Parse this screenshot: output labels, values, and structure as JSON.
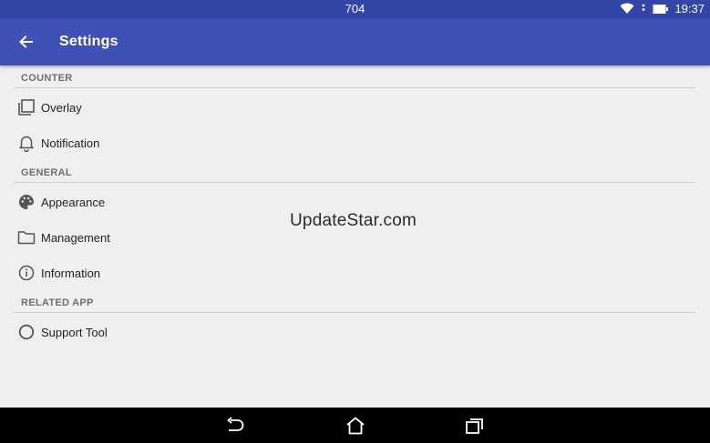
{
  "status_bar": {
    "center_text": "704",
    "time": "19:37"
  },
  "app_bar": {
    "title": "Settings"
  },
  "sections": [
    {
      "header": "COUNTER",
      "items": [
        {
          "label": "Overlay",
          "icon": "overlay-icon"
        },
        {
          "label": "Notification",
          "icon": "bell-icon"
        }
      ]
    },
    {
      "header": "GENERAL",
      "items": [
        {
          "label": "Appearance",
          "icon": "palette-icon"
        },
        {
          "label": "Management",
          "icon": "folder-icon"
        },
        {
          "label": "Information",
          "icon": "info-icon"
        }
      ]
    },
    {
      "header": "RELATED APP",
      "items": [
        {
          "label": "Support Tool",
          "icon": "circle-icon"
        }
      ]
    }
  ],
  "watermark": "UpdateStar.com",
  "colors": {
    "status_bar": "#3445a8",
    "app_bar": "#3f51b5",
    "background": "#efefef"
  }
}
